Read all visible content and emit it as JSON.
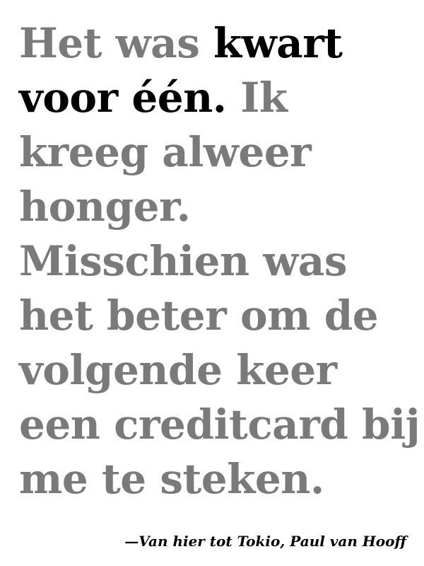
{
  "quote": {
    "line1_muted": "Het was ",
    "line1_emph": "kwart",
    "line2_emph": "voor één.",
    "line2_muted": " Ik",
    "line3": "kreeg alweer",
    "line4": "honger.",
    "line5": "Misschien was",
    "line6": "het beter om de",
    "line7": "volgende keer",
    "line8": "een creditcard bij",
    "line9": "me te steken."
  },
  "attribution": {
    "text": "—Van hier tot Tokio, Paul van Hooff"
  },
  "colors": {
    "muted_text": "#7a7a7a",
    "emphasis_text": "#000000",
    "background": "#ffffff"
  }
}
